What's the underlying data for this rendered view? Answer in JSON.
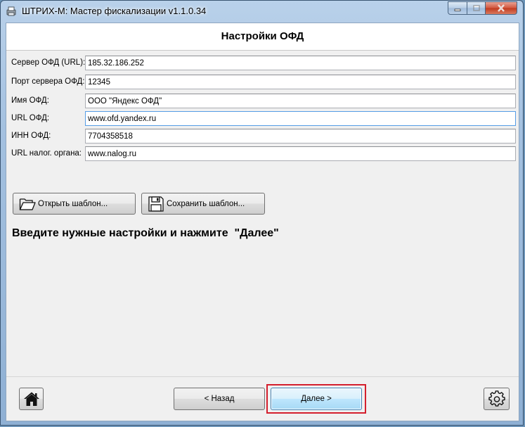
{
  "window": {
    "title": "ШТРИХ-М: Мастер фискализации v1.1.0.34",
    "minimize_icon": "minimize-icon",
    "maximize_icon": "maximize-icon",
    "close_icon": "close-icon"
  },
  "header": {
    "title": "Настройки ОФД"
  },
  "form": {
    "fields": [
      {
        "label": "Сервер ОФД (URL):",
        "value": "185.32.186.252"
      },
      {
        "label": "Порт сервера ОФД:",
        "value": "12345"
      },
      {
        "label": "Имя ОФД:",
        "value": "ООО \"Яндекс ОФД\""
      },
      {
        "label": "URL ОФД:",
        "value": "www.ofd.yandex.ru"
      },
      {
        "label": "ИНН ОФД:",
        "value": "7704358518"
      },
      {
        "label": "URL налог. органа:",
        "value": "www.nalog.ru"
      }
    ]
  },
  "templates": {
    "open_label": "Открыть шаблон...",
    "open_icon": "folder-open-icon",
    "save_label": "Сохранить шаблон...",
    "save_icon": "floppy-disk-icon"
  },
  "instruction": "Введите нужные настройки и нажмите  \"Далее\"",
  "navigation": {
    "home_icon": "home-icon",
    "back_label": "< Назад",
    "next_label": "Далее >",
    "settings_icon": "gear-icon",
    "highlight_color": "#d41f2d"
  }
}
